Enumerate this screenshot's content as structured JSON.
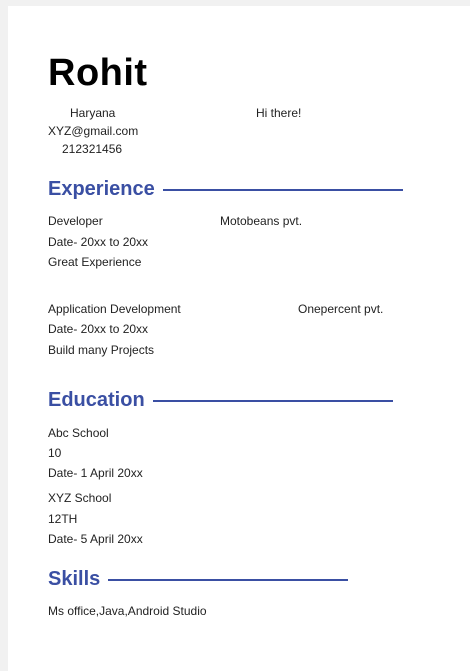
{
  "header": {
    "name": "Rohit",
    "location": "Haryana",
    "email": "XYZ@gmail.com",
    "phone": "212321456",
    "greeting": "Hi there!"
  },
  "experience": {
    "title": "Experience",
    "jobs": [
      {
        "role": "Developer",
        "company": "Motobeans pvt.",
        "date": "Date- 20xx to 20xx",
        "desc": "Great Experience"
      },
      {
        "role": "Application Development",
        "company": "Onepercent pvt.",
        "date": "Date- 20xx  to 20xx",
        "desc": "Build many Projects"
      }
    ]
  },
  "education": {
    "title": "Education",
    "entries": [
      {
        "school": "Abc School",
        "grade": "10",
        "date": "Date- 1 April 20xx"
      },
      {
        "school": "XYZ School",
        "grade": "12TH",
        "date": "Date- 5 April 20xx"
      }
    ]
  },
  "skills": {
    "title": "Skills",
    "list": "Ms office,Java,Android Studio"
  },
  "colors": {
    "accent": "#3a4fa3",
    "text": "#222222",
    "page": "#ffffff",
    "background": "#f1f1f1"
  }
}
